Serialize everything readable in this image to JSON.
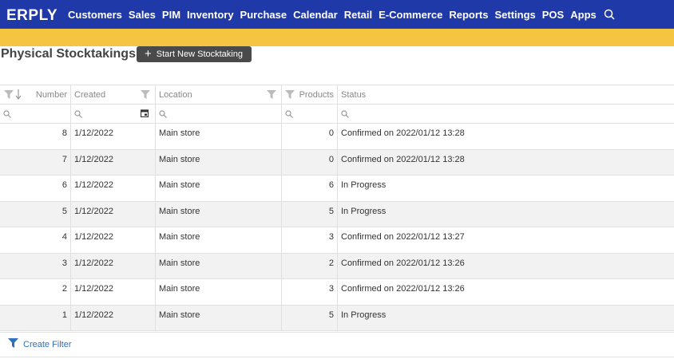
{
  "app": {
    "brand": "ERPLY"
  },
  "nav": {
    "items": [
      "Customers",
      "Sales",
      "PIM",
      "Inventory",
      "Purchase",
      "Calendar",
      "Retail",
      "E-Commerce",
      "Reports",
      "Settings",
      "POS",
      "Apps"
    ]
  },
  "page": {
    "title": "Physical Stocktakings",
    "new_button": "Start New Stocktaking"
  },
  "table": {
    "columns": [
      "Number",
      "Created",
      "Location",
      "Products",
      "Status"
    ],
    "rows": [
      {
        "number": "8",
        "created": "1/12/2022",
        "location": "Main store",
        "products": "0",
        "status": "Confirmed on 2022/01/12 13:28"
      },
      {
        "number": "7",
        "created": "1/12/2022",
        "location": "Main store",
        "products": "0",
        "status": "Confirmed on 2022/01/12 13:28"
      },
      {
        "number": "6",
        "created": "1/12/2022",
        "location": "Main store",
        "products": "6",
        "status": "In Progress"
      },
      {
        "number": "5",
        "created": "1/12/2022",
        "location": "Main store",
        "products": "5",
        "status": "In Progress"
      },
      {
        "number": "4",
        "created": "1/12/2022",
        "location": "Main store",
        "products": "3",
        "status": "Confirmed on 2022/01/12 13:27"
      },
      {
        "number": "3",
        "created": "1/12/2022",
        "location": "Main store",
        "products": "2",
        "status": "Confirmed on 2022/01/12 13:26"
      },
      {
        "number": "2",
        "created": "1/12/2022",
        "location": "Main store",
        "products": "3",
        "status": "Confirmed on 2022/01/12 13:26"
      },
      {
        "number": "1",
        "created": "1/12/2022",
        "location": "Main store",
        "products": "5",
        "status": "In Progress"
      }
    ]
  },
  "footer": {
    "create_filter": "Create Filter"
  },
  "colors": {
    "nav_bg": "#1f3aa8",
    "accent_yellow": "#f5c542",
    "link_blue": "#2e6fbe"
  }
}
